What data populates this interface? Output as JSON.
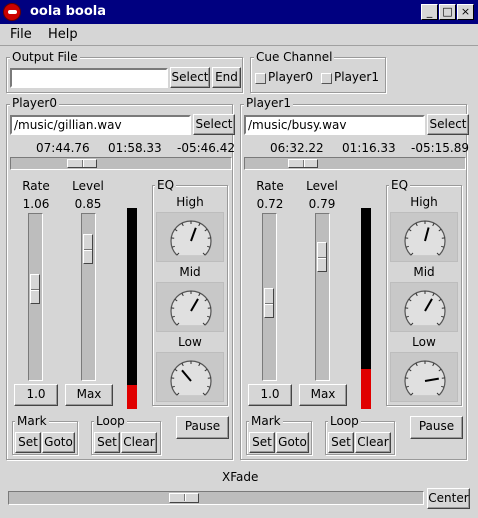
{
  "window": {
    "title": "oola boola",
    "min": "_",
    "max": "□",
    "close": "×"
  },
  "menu": {
    "file": "File",
    "help": "Help"
  },
  "output": {
    "title": "Output File",
    "value": "",
    "select": "Select",
    "end": "End"
  },
  "cue": {
    "title": "Cue Channel",
    "p0": "Player0",
    "p1": "Player1"
  },
  "players": [
    {
      "title": "Player0",
      "file": "/music/gillian.wav",
      "select": "Select",
      "elapsed": "07:44.76",
      "total": "01:58.33",
      "remaining": "-05:46.42",
      "position": 0.3,
      "rate_label": "Rate",
      "rate": "1.06",
      "rate_level": 0.55,
      "level_label": "Level",
      "level": "0.85",
      "level_level": 0.85,
      "meter_level": 0.12,
      "reset_label": "1.0",
      "max_label": "Max",
      "eq": {
        "title": "EQ",
        "high": "High",
        "mid": "Mid",
        "low": "Low"
      },
      "mark": {
        "title": "Mark",
        "set": "Set",
        "goto": "Goto"
      },
      "loop": {
        "title": "Loop",
        "set": "Set",
        "clear": "Clear"
      },
      "pause": "Pause"
    },
    {
      "title": "Player1",
      "file": "/music/busy.wav",
      "select": "Select",
      "elapsed": "06:32.22",
      "total": "01:16.33",
      "remaining": "-05:15.89",
      "position": 0.23,
      "rate_label": "Rate",
      "rate": "0.72",
      "rate_level": 0.45,
      "level_label": "Level",
      "level": "0.79",
      "level_level": 0.79,
      "meter_level": 0.2,
      "reset_label": "1.0",
      "max_label": "Max",
      "eq": {
        "title": "EQ",
        "high": "High",
        "mid": "Mid",
        "low": "Low"
      },
      "mark": {
        "title": "Mark",
        "set": "Set",
        "goto": "Goto"
      },
      "loop": {
        "title": "Loop",
        "set": "Set",
        "clear": "Clear"
      },
      "pause": "Pause"
    }
  ],
  "xfade": {
    "label": "XFade",
    "center": "Center",
    "value": 0.42
  }
}
